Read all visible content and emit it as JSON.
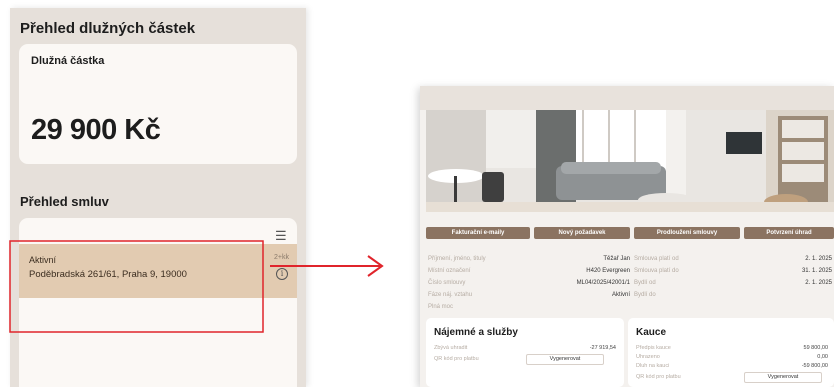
{
  "left": {
    "debt_title": "Přehled dlužných částek",
    "debt_label": "Dlužná částka",
    "debt_amount": "29 900 Kč",
    "contracts_title": "Přehled smluv",
    "contract": {
      "status": "Aktivní",
      "address": "Poděbradská 261/61, Praha 9, 19000",
      "short": "2+kk"
    }
  },
  "right": {
    "buttons": [
      "Fakturační e-maily",
      "Nový požadavek",
      "Prodloužení smlouvy",
      "Potvrzení úhrad"
    ],
    "details": [
      {
        "label": "Příjmení, jméno, tituly",
        "value": "Těžař Jan"
      },
      {
        "label": "Místní označení",
        "value": "H420 Evergreen"
      },
      {
        "label": "Číslo smlouvy",
        "value": "ML04/2025/42001/1"
      },
      {
        "label": "Fáze náj. vztahu",
        "value": "Aktivní"
      },
      {
        "label": "Plná moc",
        "value": ""
      }
    ],
    "details2": [
      {
        "label": "Smlouva platí od",
        "value": "2. 1. 2025"
      },
      {
        "label": "Smlouva platí do",
        "value": "31. 1. 2025"
      },
      {
        "label": "Bydlí od",
        "value": "2. 1. 2025"
      },
      {
        "label": "Bydlí do",
        "value": ""
      }
    ],
    "rent": {
      "title": "Nájemné a služby",
      "owed_label": "Zbývá uhradit",
      "owed_value": "-27 919,54",
      "qr_label": "QR kód pro platbu",
      "generate": "Vygenerovat"
    },
    "deposit": {
      "title": "Kauce",
      "rows": [
        {
          "label": "Předpis kauce",
          "value": "59 800,00"
        },
        {
          "label": "Uhrazeno",
          "value": "0,00"
        },
        {
          "label": "Dluh na kauci",
          "value": "-59 800,00"
        }
      ],
      "qr_label": "QR kód pro platbu",
      "generate": "Vygenerovat"
    }
  },
  "colors": {
    "highlight": "#e0242b",
    "accent": "#8b7361",
    "row_bg": "#e2cbb1"
  }
}
